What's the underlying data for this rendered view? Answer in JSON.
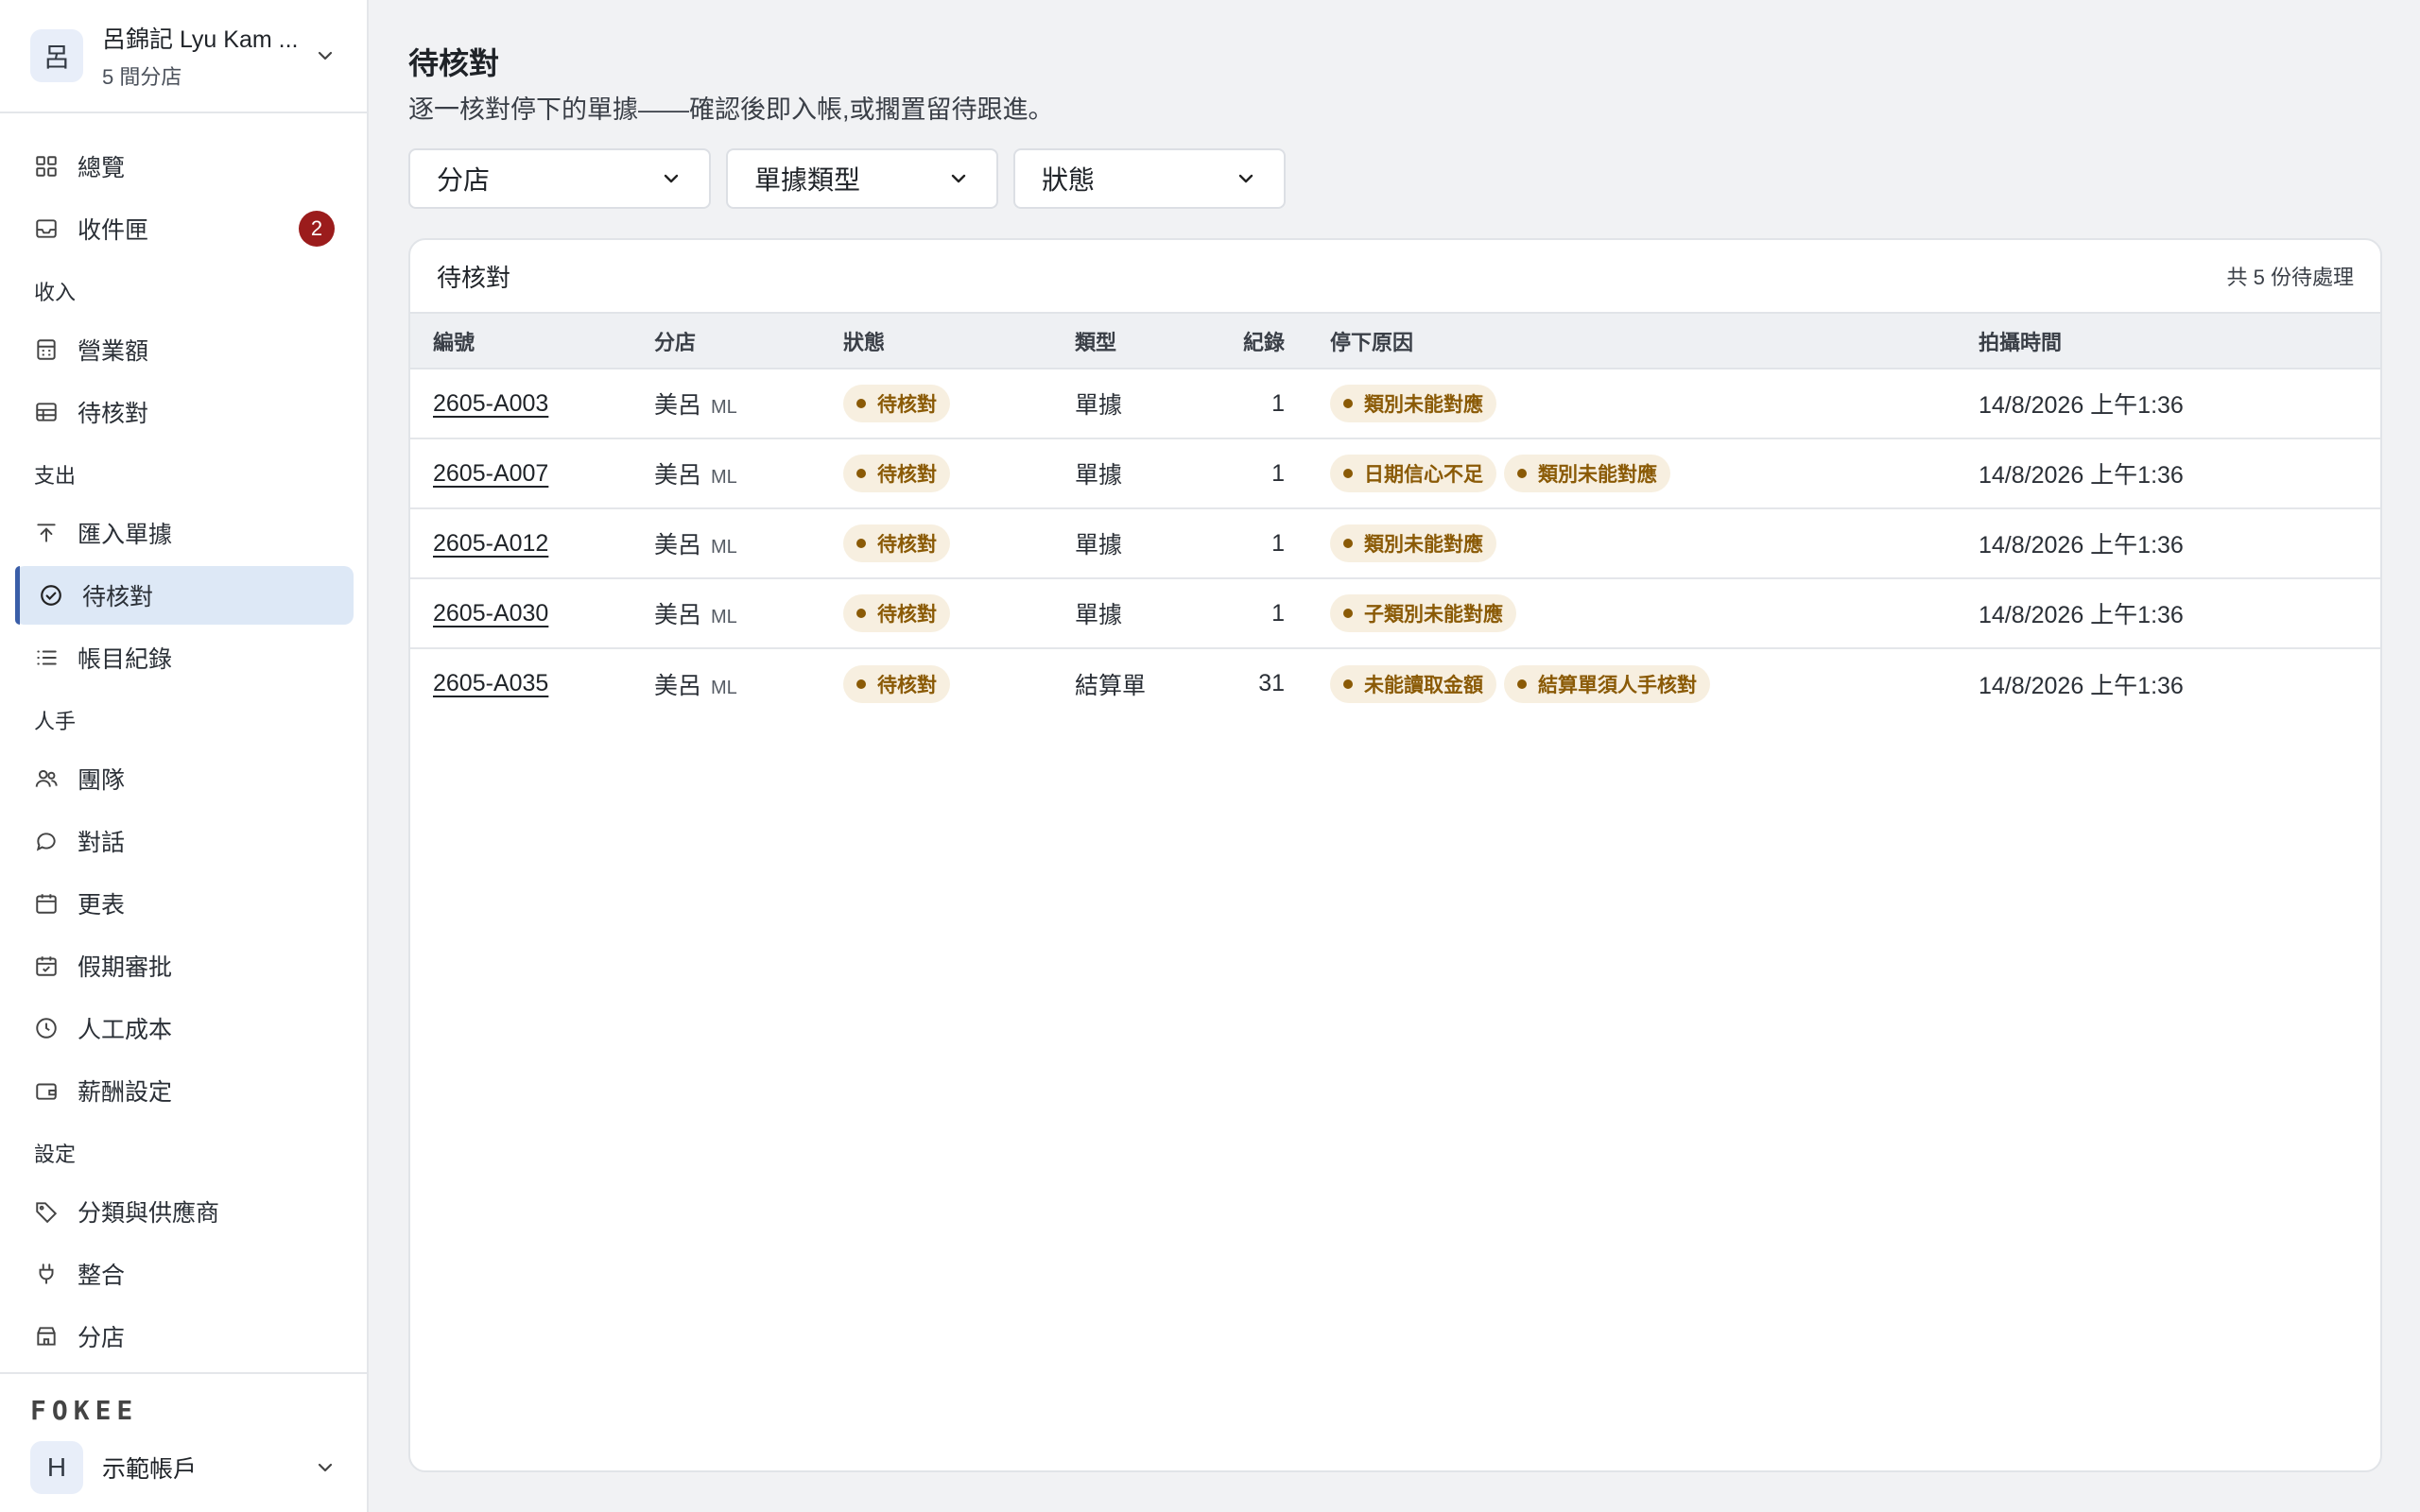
{
  "org": {
    "avatar": "呂",
    "name": "呂錦記 Lyu Kam ...",
    "branches": "5 間分店"
  },
  "nav": {
    "overview": "總覽",
    "inbox": "收件匣",
    "inbox_badge": "2",
    "section_income": "收入",
    "revenue": "營業額",
    "income_pending": "待核對",
    "section_expense": "支出",
    "import_receipts": "匯入單據",
    "expense_pending": "待核對",
    "ledger": "帳目紀錄",
    "section_staff": "人手",
    "team": "團隊",
    "chat": "對話",
    "roster": "更表",
    "leave": "假期審批",
    "labor_cost": "人工成本",
    "payroll": "薪酬設定",
    "section_settings": "設定",
    "categories": "分類與供應商",
    "integrations": "整合",
    "branches": "分店"
  },
  "footer": {
    "logo": "FOKEE",
    "account_avatar": "H",
    "account_name": "示範帳戶"
  },
  "page": {
    "title": "待核對",
    "subtitle": "逐一核對停下的單據——確認後即入帳,或擱置留待跟進。"
  },
  "filters": {
    "branch": "分店",
    "doc_type": "單據類型",
    "status": "狀態"
  },
  "card": {
    "title": "待核對",
    "count": "共 5 份待處理"
  },
  "table": {
    "headers": {
      "id": "編號",
      "branch": "分店",
      "status": "狀態",
      "type": "類型",
      "records": "紀錄",
      "reason": "停下原因",
      "time": "拍攝時間"
    },
    "rows": [
      {
        "id": "2605-A003",
        "branch": "美呂",
        "code": "ML",
        "status": "待核對",
        "type": "單據",
        "records": "1",
        "reasons": [
          "類別未能對應"
        ],
        "time": "14/8/2026 上午1:36"
      },
      {
        "id": "2605-A007",
        "branch": "美呂",
        "code": "ML",
        "status": "待核對",
        "type": "單據",
        "records": "1",
        "reasons": [
          "日期信心不足",
          "類別未能對應"
        ],
        "time": "14/8/2026 上午1:36"
      },
      {
        "id": "2605-A012",
        "branch": "美呂",
        "code": "ML",
        "status": "待核對",
        "type": "單據",
        "records": "1",
        "reasons": [
          "類別未能對應"
        ],
        "time": "14/8/2026 上午1:36"
      },
      {
        "id": "2605-A030",
        "branch": "美呂",
        "code": "ML",
        "status": "待核對",
        "type": "單據",
        "records": "1",
        "reasons": [
          "子類別未能對應"
        ],
        "time": "14/8/2026 上午1:36"
      },
      {
        "id": "2605-A035",
        "branch": "美呂",
        "code": "ML",
        "status": "待核對",
        "type": "結算單",
        "records": "31",
        "reasons": [
          "未能讀取金額",
          "結算單須人手核對"
        ],
        "time": "14/8/2026 上午1:36"
      }
    ]
  },
  "colors": {
    "accent": "#3a5ea8",
    "badge": "#9b1c1c",
    "pill_bg": "#f7efe0",
    "pill_text": "#8a5a06"
  }
}
